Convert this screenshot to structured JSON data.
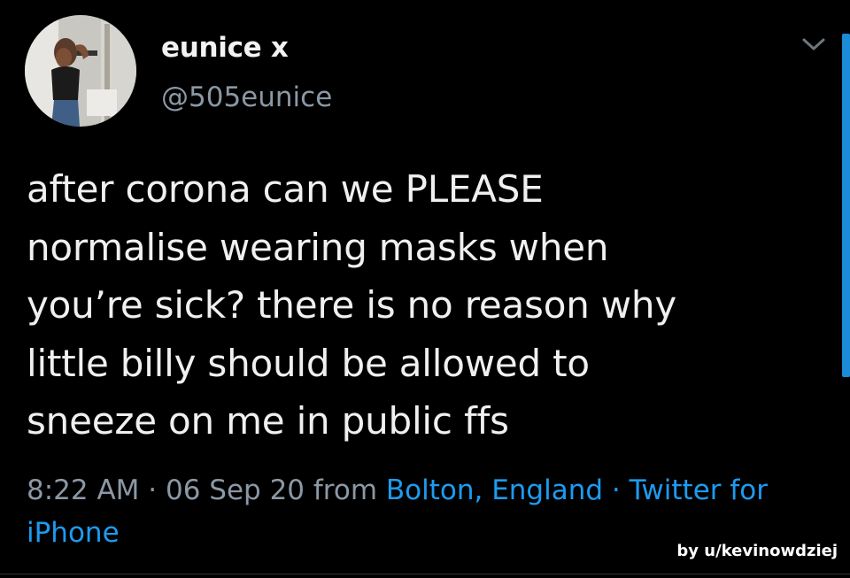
{
  "author": {
    "display_name": "eunice x",
    "handle": "@505eunice"
  },
  "tweet": {
    "lines": [
      "after corona can we PLEASE",
      "normalise wearing masks when",
      "you’re sick? there is no reason why",
      "little billy should be allowed to",
      "sneeze on me in public ffs"
    ]
  },
  "meta": {
    "time": "8:22 AM",
    "sep1": " · ",
    "date": "06 Sep 20",
    "from": " from ",
    "location": "Bolton, England",
    "sep2": " · ",
    "client": "Twitter for iPhone"
  },
  "credit": "by u/kevinowdziej",
  "icons": {
    "menu": "chevron-down-icon",
    "avatar": "profile-photo"
  },
  "colors": {
    "background": "#000000",
    "link": "#1d9bf0",
    "secondary_text": "#8b98a5",
    "scrollbar": "#1a8cd8"
  }
}
